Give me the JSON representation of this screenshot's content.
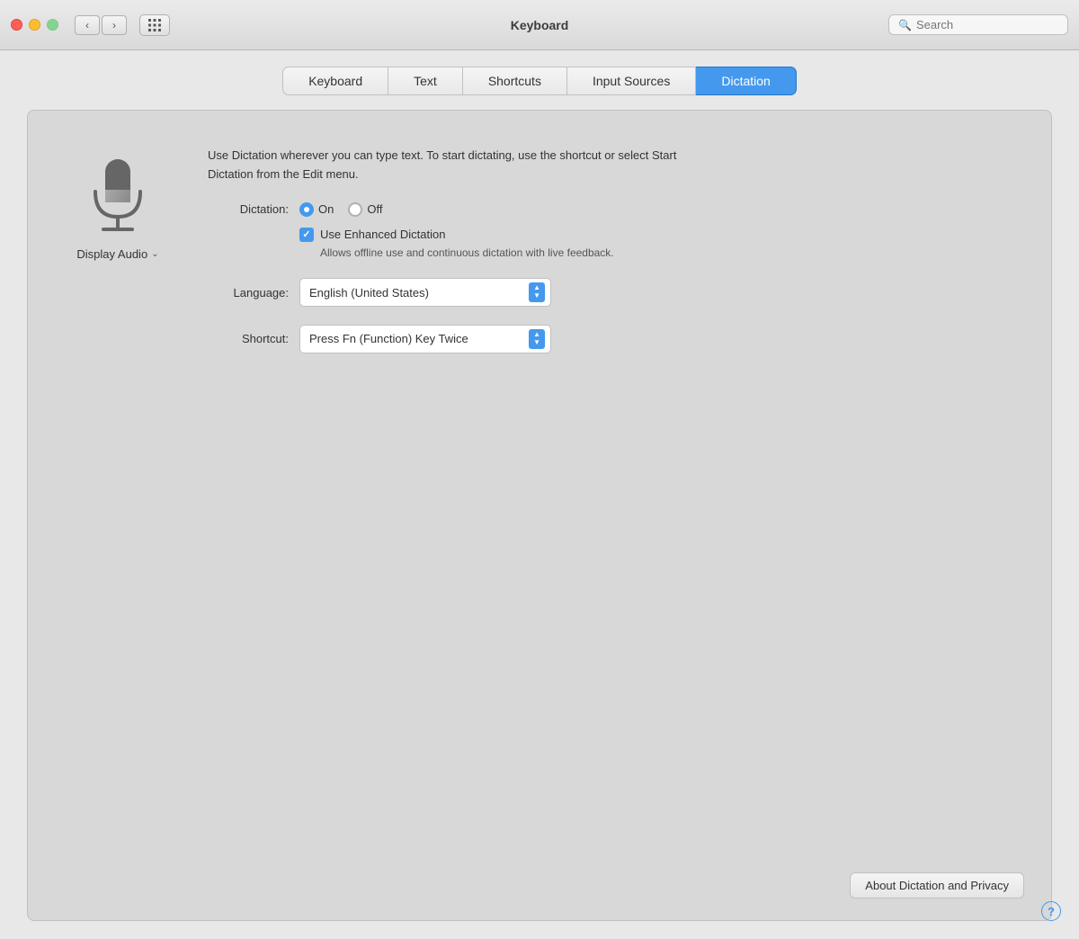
{
  "window": {
    "title": "Keyboard"
  },
  "titlebar": {
    "search_placeholder": "Search"
  },
  "tabs": [
    {
      "id": "keyboard",
      "label": "Keyboard",
      "active": false
    },
    {
      "id": "text",
      "label": "Text",
      "active": false
    },
    {
      "id": "shortcuts",
      "label": "Shortcuts",
      "active": false
    },
    {
      "id": "input-sources",
      "label": "Input Sources",
      "active": false
    },
    {
      "id": "dictation",
      "label": "Dictation",
      "active": true
    }
  ],
  "dictation": {
    "description": "Use Dictation wherever you can type text. To start dictating,\nuse the shortcut or select Start Dictation from the Edit menu.",
    "dictation_label": "Dictation:",
    "on_label": "On",
    "off_label": "Off",
    "dictation_on": true,
    "enhanced_label": "Use Enhanced Dictation",
    "enhanced_sublabel": "Allows offline use and continuous dictation with\nlive feedback.",
    "enhanced_checked": true,
    "language_label": "Language:",
    "language_value": "English (United States)",
    "shortcut_label": "Shortcut:",
    "shortcut_value": "Press Fn (Function) Key Twice",
    "display_audio_label": "Display Audio",
    "about_btn_label": "About Dictation and Privacy",
    "help_label": "?"
  }
}
